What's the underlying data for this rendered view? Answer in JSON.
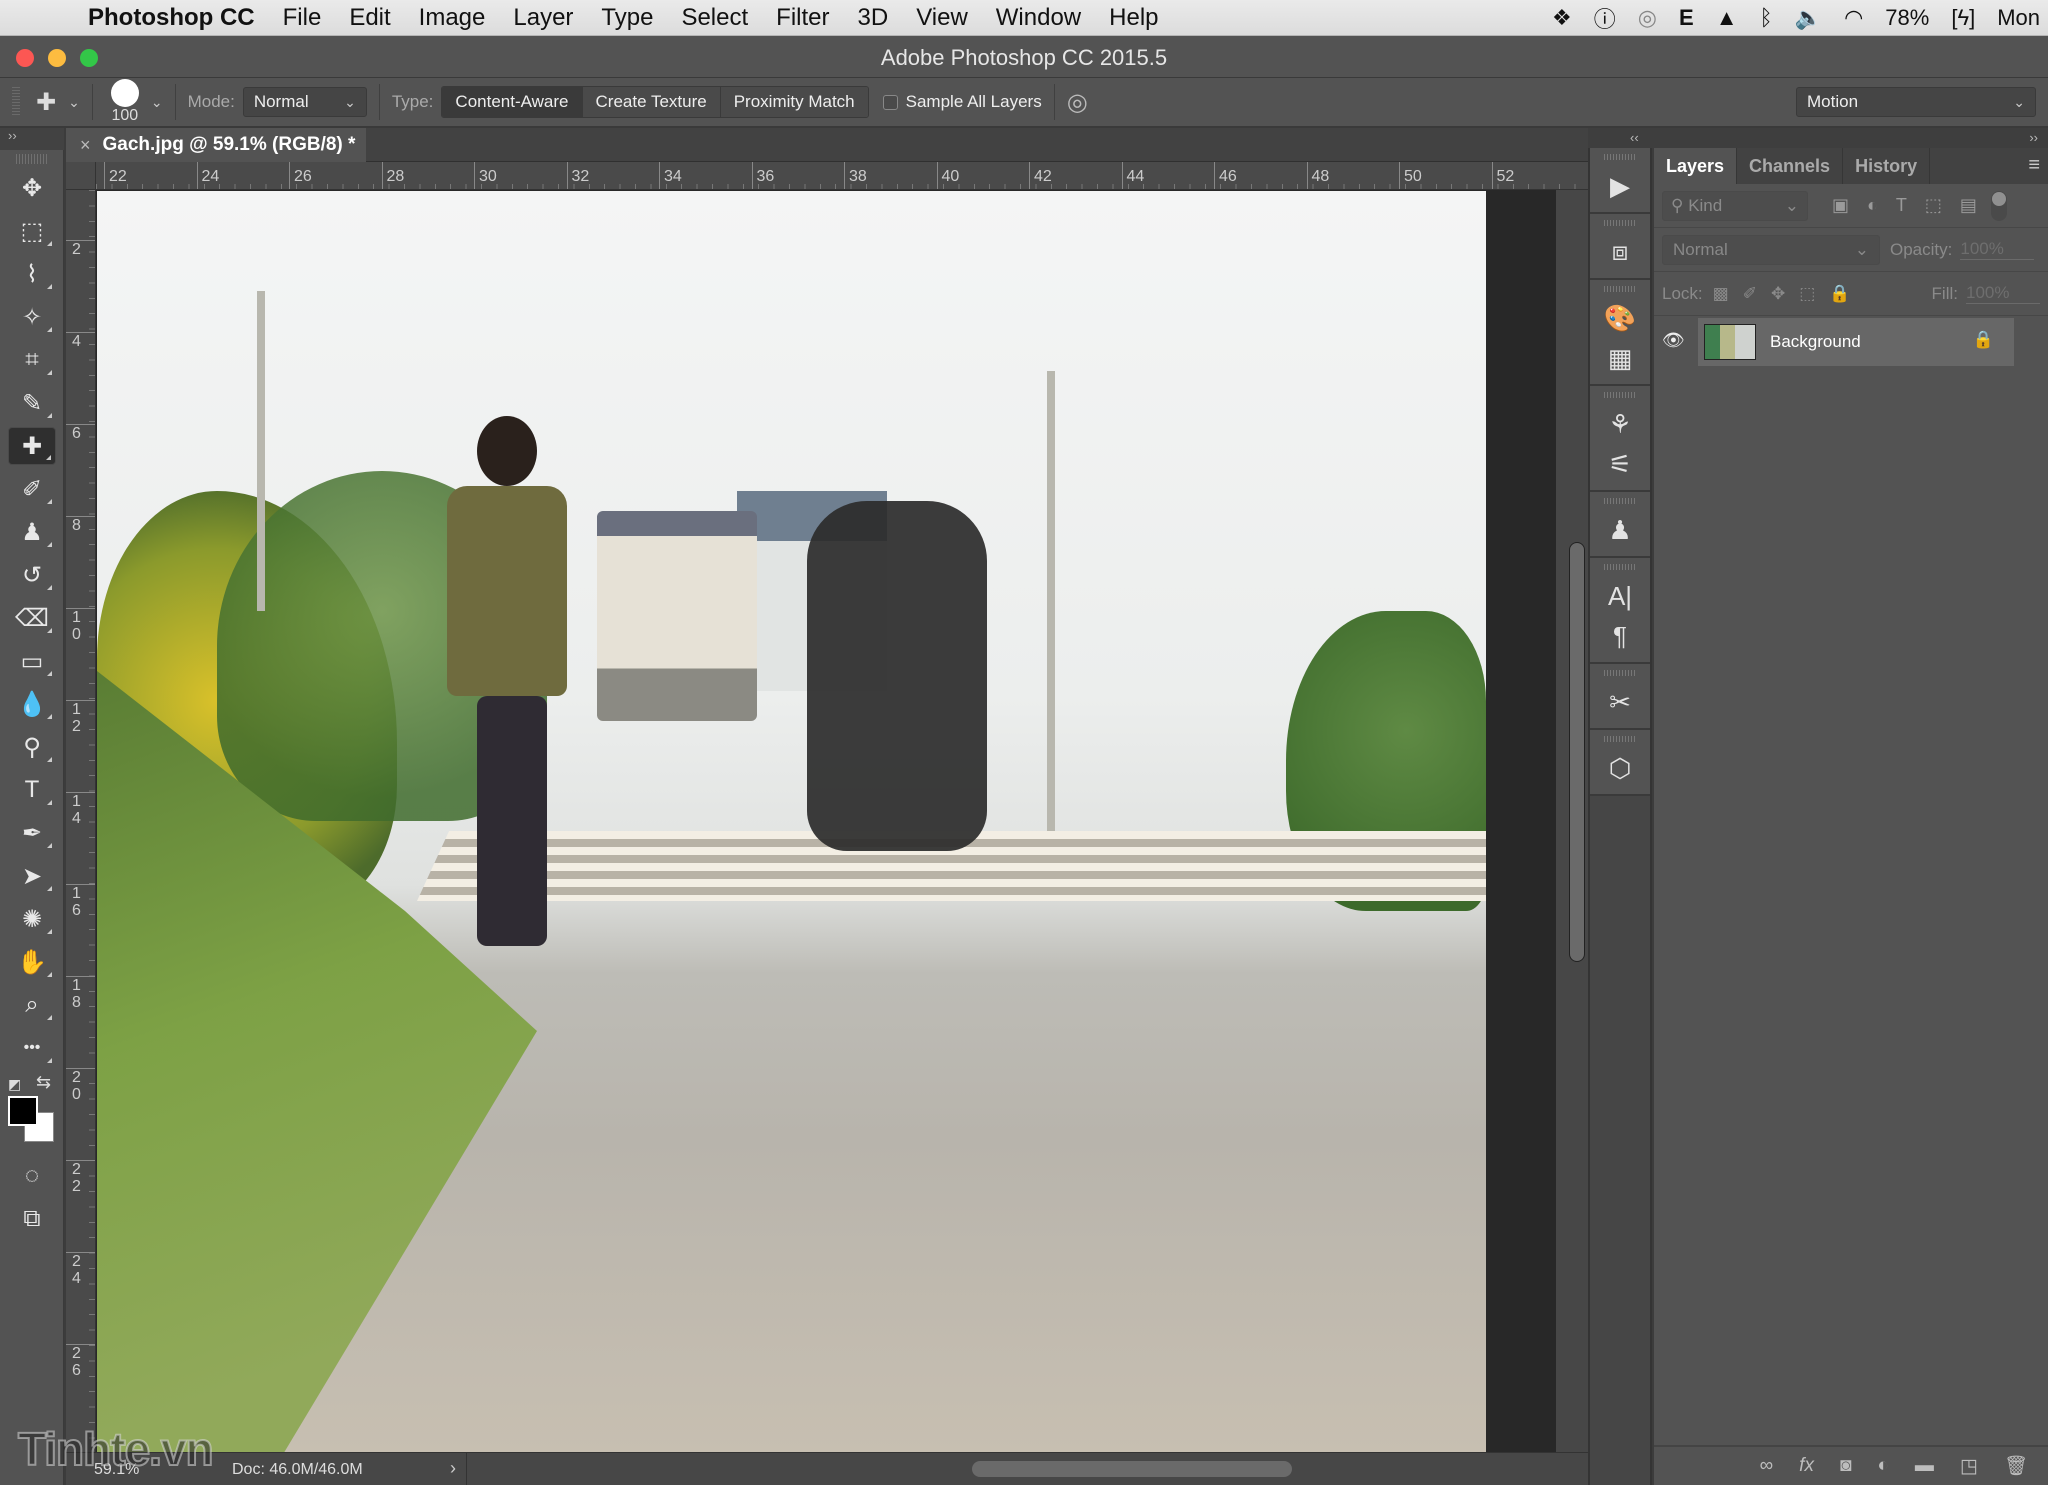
{
  "menubar": {
    "app_name": "Photoshop CC",
    "items": [
      "File",
      "Edit",
      "Image",
      "Layer",
      "Type",
      "Select",
      "Filter",
      "3D",
      "View",
      "Window",
      "Help"
    ],
    "status": {
      "battery": "78%",
      "clock": "Mon",
      "icons": [
        "dropbox-icon",
        "onepassword-icon",
        "creative-cloud-icon",
        "evernote-icon",
        "google-drive-icon",
        "bluetooth-icon",
        "volume-icon",
        "wifi-icon",
        "battery-charging-icon"
      ]
    }
  },
  "window": {
    "title": "Adobe Photoshop CC 2015.5"
  },
  "options_bar": {
    "brush_size": "100",
    "mode_label": "Mode:",
    "mode_value": "Normal",
    "type_label": "Type:",
    "type_options": [
      {
        "label": "Content-Aware",
        "active": true
      },
      {
        "label": "Create Texture",
        "active": false
      },
      {
        "label": "Proximity Match",
        "active": false
      }
    ],
    "sample_all_layers_label": "Sample All Layers",
    "sample_all_layers_checked": false,
    "workspace": "Motion"
  },
  "toolbar": {
    "collapse_glyph": "››",
    "tools": [
      {
        "name": "move-tool",
        "glyph": "✥",
        "active": false
      },
      {
        "name": "marquee-tool",
        "glyph": "⬚",
        "active": false
      },
      {
        "name": "lasso-tool",
        "glyph": "⌇",
        "active": false
      },
      {
        "name": "magic-wand-tool",
        "glyph": "✧",
        "active": false
      },
      {
        "name": "crop-tool",
        "glyph": "⌗",
        "active": false
      },
      {
        "name": "eyedropper-tool",
        "glyph": "✎",
        "active": false
      },
      {
        "name": "spot-healing-brush-tool",
        "glyph": "✚",
        "active": true
      },
      {
        "name": "brush-tool",
        "glyph": "✐",
        "active": false
      },
      {
        "name": "clone-stamp-tool",
        "glyph": "♟",
        "active": false
      },
      {
        "name": "history-brush-tool",
        "glyph": "↺",
        "active": false
      },
      {
        "name": "eraser-tool",
        "glyph": "⌫",
        "active": false
      },
      {
        "name": "gradient-tool",
        "glyph": "▭",
        "active": false
      },
      {
        "name": "blur-tool",
        "glyph": "💧",
        "active": false
      },
      {
        "name": "dodge-tool",
        "glyph": "⚲",
        "active": false
      },
      {
        "name": "type-tool",
        "glyph": "T",
        "active": false
      },
      {
        "name": "pen-tool",
        "glyph": "✒",
        "active": false
      },
      {
        "name": "path-selection-tool",
        "glyph": "➤",
        "active": false
      },
      {
        "name": "custom-shape-tool",
        "glyph": "✺",
        "active": false
      },
      {
        "name": "hand-tool",
        "glyph": "✋",
        "active": false
      },
      {
        "name": "zoom-tool",
        "glyph": "⌕",
        "active": false
      },
      {
        "name": "edit-toolbar-tool",
        "glyph": "•••",
        "active": false
      }
    ],
    "bottom_tools": [
      {
        "name": "quick-mask-tool",
        "glyph": "◌"
      },
      {
        "name": "screen-mode-tool",
        "glyph": "⧉"
      }
    ],
    "foreground_color": "#000000",
    "background_color": "#ffffff"
  },
  "document": {
    "tab_title": "Gach.jpg @ 59.1% (RGB/8) *",
    "close_glyph": "×",
    "ruler_h": [
      "22",
      "24",
      "26",
      "28",
      "30",
      "32",
      "34",
      "36",
      "38",
      "40",
      "42",
      "44",
      "46",
      "48",
      "50",
      "52"
    ],
    "ruler_v": [
      "2",
      "4",
      "6",
      "8",
      "1\n0",
      "1\n2",
      "1\n4",
      "1\n6",
      "1\n8",
      "2\n0",
      "2\n2",
      "2\n4",
      "2\n6"
    ],
    "zoom": "59.1%",
    "doc_size": "Doc: 46.0M/46.0M",
    "status_arrow": "›"
  },
  "watermark": "Tinhte.vn",
  "dock": {
    "collapse_left": "‹‹",
    "collapse_right": "››",
    "groups": [
      [
        "play-actions-icon"
      ],
      [
        "3d-materials-icon"
      ],
      [
        "color-palette-icon",
        "swatches-grid-icon"
      ],
      [
        "brushes-icon",
        "brush-settings-icon"
      ],
      [
        "clone-source-icon"
      ],
      [
        "character-icon",
        "paragraph-icon"
      ],
      [
        "tool-presets-icon"
      ],
      [
        "3d-cube-icon"
      ]
    ],
    "glyphs": {
      "play-actions-icon": "▶",
      "3d-materials-icon": "⧈",
      "color-palette-icon": "🎨",
      "swatches-grid-icon": "▦",
      "brushes-icon": "⚘",
      "brush-settings-icon": "⚟",
      "clone-source-icon": "♟",
      "character-icon": "A|",
      "paragraph-icon": "¶",
      "tool-presets-icon": "✂",
      "3d-cube-icon": "⬡"
    }
  },
  "layers_panel": {
    "tabs": [
      {
        "label": "Layers",
        "active": true
      },
      {
        "label": "Channels",
        "active": false
      },
      {
        "label": "History",
        "active": false
      }
    ],
    "menu_glyph": "≡",
    "filter_kind": "Kind",
    "blend_mode": "Normal",
    "opacity_label": "Opacity:",
    "opacity_value": "100%",
    "lock_label": "Lock:",
    "fill_label": "Fill:",
    "fill_value": "100%",
    "layers": [
      {
        "name": "Background",
        "visible": true,
        "locked": true
      }
    ],
    "footer_icons": [
      "link-layers-icon",
      "fx-icon",
      "add-mask-icon",
      "adjustment-layer-icon",
      "new-group-icon",
      "new-layer-icon",
      "delete-layer-icon"
    ]
  }
}
